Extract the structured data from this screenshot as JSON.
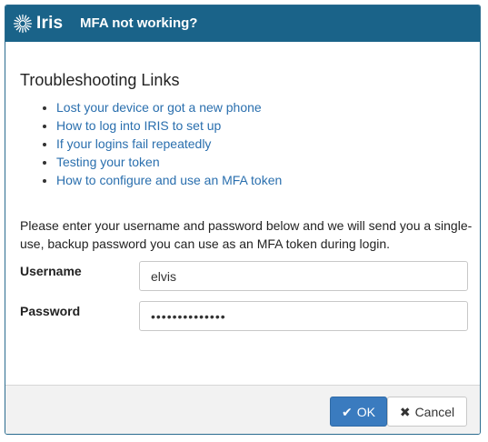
{
  "header": {
    "logo_text": "Iris",
    "title": "MFA not working?"
  },
  "troubleshooting": {
    "heading": "Troubleshooting Links",
    "links": [
      "Lost your device or got a new phone",
      "How to log into IRIS to set up",
      "If your logins fail repeatedly",
      "Testing your token",
      "How to configure and use an MFA token"
    ]
  },
  "form": {
    "intro": "Please enter your username and password below and we will send you a single-use, backup password you can use as an MFA token during login.",
    "username_label": "Username",
    "username_value": "elvis",
    "password_label": "Password",
    "password_value": "••••••••••••••"
  },
  "buttons": {
    "ok_label": "OK",
    "ok_icon": "check-icon",
    "cancel_label": "Cancel",
    "cancel_icon": "times-icon"
  },
  "colors": {
    "header_bg": "#1a6389",
    "link": "#2a6fae",
    "ok_bg": "#3a7bbf"
  }
}
